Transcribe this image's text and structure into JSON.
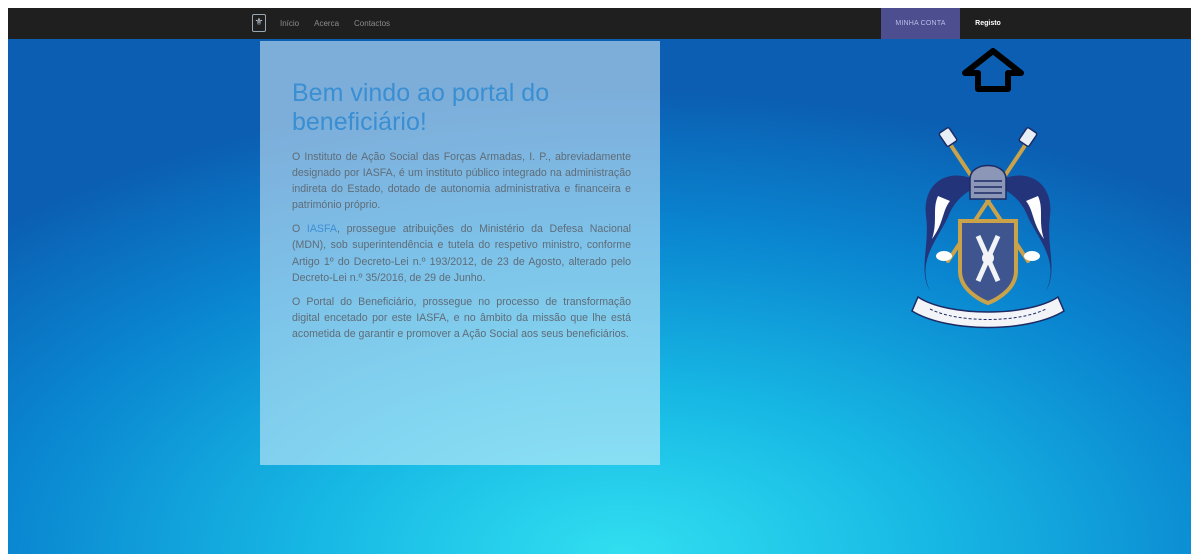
{
  "navbar": {
    "brand_icon": "iasfa-logo-icon",
    "links": [
      "Início",
      "Acerca",
      "Contactos"
    ],
    "account_label": "MINHA CONTA",
    "register_label": "Registo",
    "colors": {
      "background": "#1f1f1f",
      "account_bg": "#4d4e8f"
    }
  },
  "annotation": {
    "icon": "arrow-up-icon"
  },
  "welcome": {
    "title": "Bem vindo ao portal do beneficiário!",
    "paragraph1": "O Instituto de Ação Social das Forças Armadas, I. P., abreviadamente designado por IASFA, é um instituto público integrado na administração indireta do Estado, dotado de autonomia administrativa e financeira e património próprio.",
    "paragraph2_link": "IASFA",
    "paragraph2_prefix": "O ",
    "paragraph2_rest": ", prossegue atribuições do Ministério da Defesa Nacional (MDN), sob superintendência e tutela do respetivo ministro, conforme Artigo 1º do Decreto-Lei n.º 193/2012, de 23 de Agosto, alterado pelo Decreto-Lei n.º 35/2016, de 29 de Junho.",
    "paragraph3": "O Portal do Beneficiário, prossegue no processo de transformação digital encetado por este IASFA, e no âmbito da missão que lhe está acometida de garantir e promover a Ação Social aos seus beneficiários."
  },
  "crest": {
    "icon": "coat-of-arms-icon"
  },
  "colors": {
    "background_center": "#31dff0",
    "background_edge": "#0b5eb2",
    "title": "#3a8ed2",
    "link": "#3e8fd4"
  }
}
